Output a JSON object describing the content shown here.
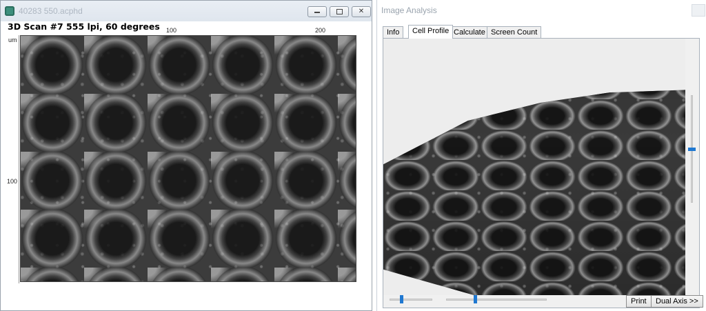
{
  "left_window": {
    "title": "40283 550.acphd",
    "scan_title": "3D Scan #7 555 lpi, 60 degrees",
    "ruler": {
      "unit": "um",
      "top_ticks": [
        "100",
        "200"
      ],
      "left_ticks": [
        "100"
      ]
    }
  },
  "right_window": {
    "title": "Image Analysis",
    "tabs": [
      {
        "label": "Info"
      },
      {
        "label": "Cell Profile"
      },
      {
        "label": "Calculate"
      },
      {
        "label": "Screen Count"
      }
    ],
    "active_tab": "Cell Profile",
    "buttons": {
      "print": "Print",
      "dual_axis": "Dual Axis >>"
    },
    "sliders": {
      "vertical_level": 0.5,
      "horizontal_1_level": 0.27,
      "horizontal_2_level": 0.29
    }
  },
  "icons": {
    "app": "app-icon",
    "minimize": "minimize-icon",
    "maximize": "maximize-icon",
    "close": "close-icon"
  },
  "colors": {
    "accent": "#1f78d1",
    "app_icon": "#3d8f7c",
    "title_inactive": "#9aa4ae"
  }
}
